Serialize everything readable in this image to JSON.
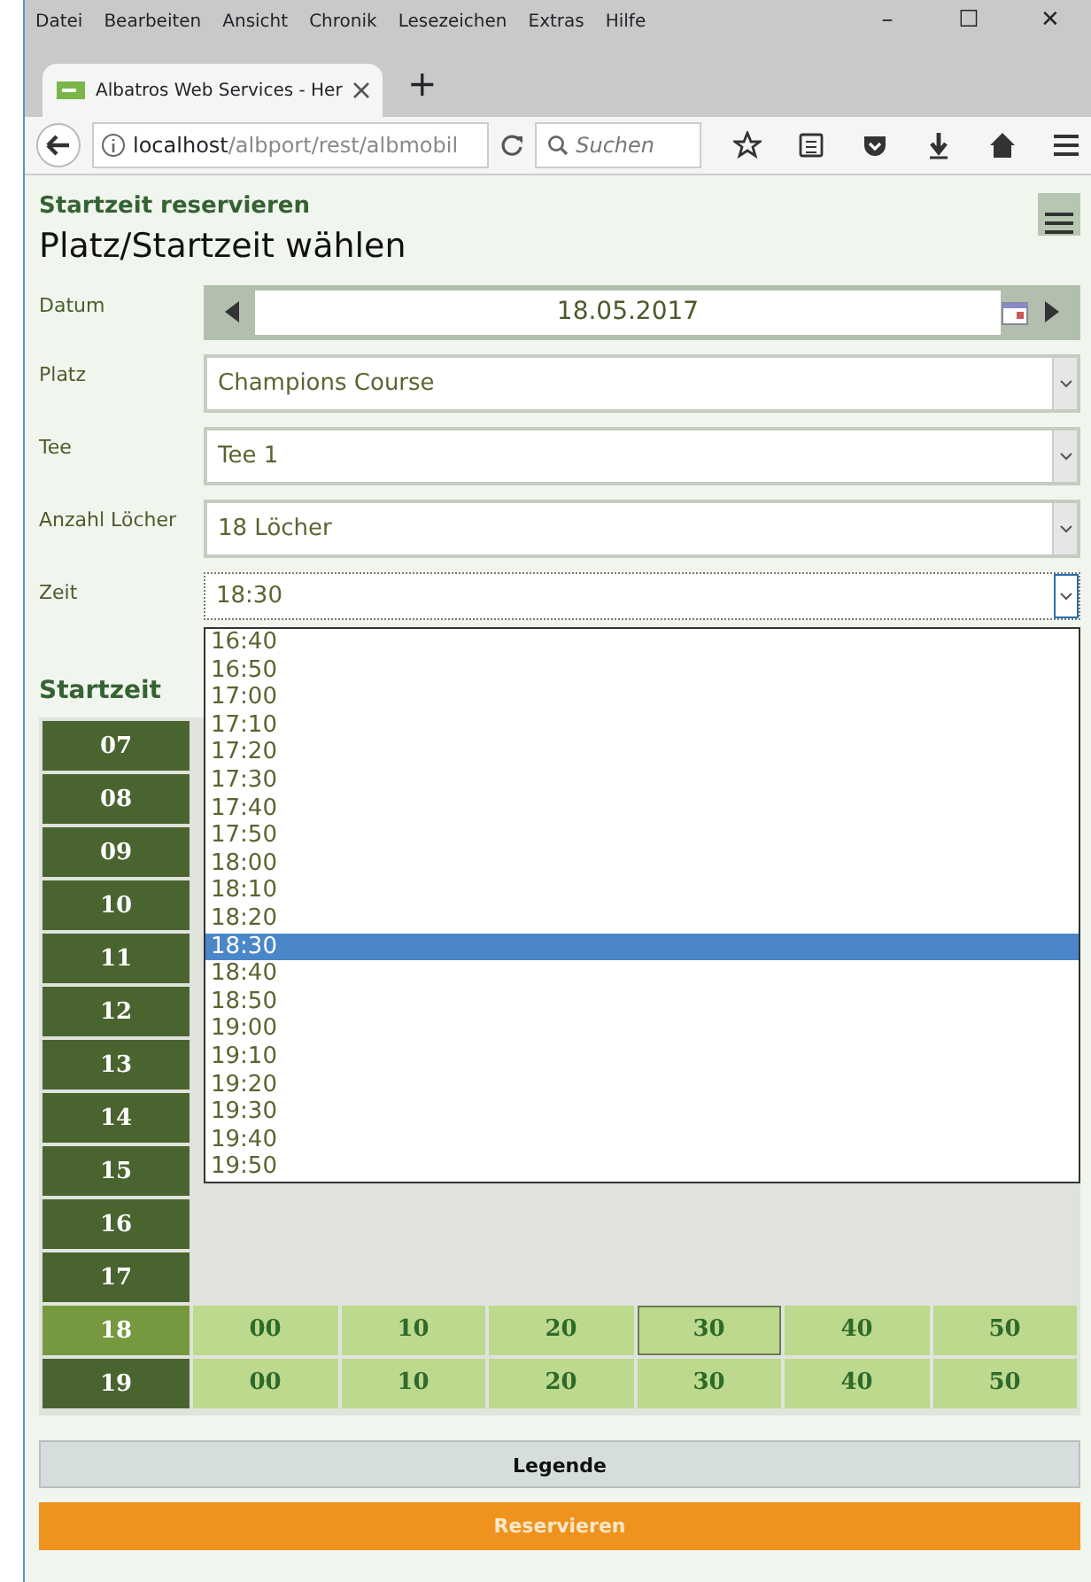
{
  "browser": {
    "menu": [
      "Datei",
      "Bearbeiten",
      "Ansicht",
      "Chronik",
      "Lesezeichen",
      "Extras",
      "Hilfe"
    ],
    "window_controls": [
      "–",
      "☐",
      "✕"
    ],
    "tabs": [
      {
        "label": "Albatros Web Services - Her",
        "selected": true
      }
    ],
    "new_tab": "+",
    "url_host": "localhost",
    "url_path": "/albport/rest/albmobil",
    "search": {
      "placeholder": "Suchen"
    }
  },
  "page": {
    "kicker": "Startzeit reservieren",
    "title": "Platz/Startzeit wählen",
    "form": [
      {
        "kind": "date",
        "label": "Datum",
        "value": "18.05.2017"
      },
      {
        "kind": "select",
        "label": "Platz",
        "value": "Champions Course",
        "expanded": false
      },
      {
        "kind": "select",
        "label": "Tee",
        "value": "Tee 1",
        "expanded": false
      },
      {
        "kind": "select",
        "label": "Anzahl Löcher",
        "value": "18 Löcher",
        "expanded": false
      },
      {
        "kind": "select",
        "label": "Zeit",
        "value": "18:30",
        "expanded": true
      }
    ],
    "dropdown": [
      {
        "label": "16:40",
        "selected": false
      },
      {
        "label": "16:50",
        "selected": false
      },
      {
        "label": "17:00",
        "selected": false
      },
      {
        "label": "17:10",
        "selected": false
      },
      {
        "label": "17:20",
        "selected": false
      },
      {
        "label": "17:30",
        "selected": false
      },
      {
        "label": "17:40",
        "selected": false
      },
      {
        "label": "17:50",
        "selected": false
      },
      {
        "label": "18:00",
        "selected": false
      },
      {
        "label": "18:10",
        "selected": false
      },
      {
        "label": "18:20",
        "selected": false
      },
      {
        "label": "18:30",
        "selected": true
      },
      {
        "label": "18:40",
        "selected": false
      },
      {
        "label": "18:50",
        "selected": false
      },
      {
        "label": "19:00",
        "selected": false
      },
      {
        "label": "19:10",
        "selected": false
      },
      {
        "label": "19:20",
        "selected": false
      },
      {
        "label": "19:30",
        "selected": false
      },
      {
        "label": "19:40",
        "selected": false
      },
      {
        "label": "19:50",
        "selected": false
      }
    ],
    "grid_title": "Startzeit",
    "hours": [
      {
        "hour": "07",
        "selected": false
      },
      {
        "hour": "08",
        "selected": false
      },
      {
        "hour": "09",
        "selected": false
      },
      {
        "hour": "10",
        "selected": false
      },
      {
        "hour": "11",
        "selected": false
      },
      {
        "hour": "12",
        "selected": false
      },
      {
        "hour": "13",
        "selected": false
      },
      {
        "hour": "14",
        "selected": false
      },
      {
        "hour": "15",
        "selected": false
      },
      {
        "hour": "16",
        "selected": false
      },
      {
        "hour": "17",
        "selected": false
      },
      {
        "hour": "18",
        "selected": true,
        "slots": [
          {
            "label": "00",
            "selected": false
          },
          {
            "label": "10",
            "selected": false
          },
          {
            "label": "20",
            "selected": false
          },
          {
            "label": "30",
            "selected": true
          },
          {
            "label": "40",
            "selected": false
          },
          {
            "label": "50",
            "selected": false
          }
        ]
      },
      {
        "hour": "19",
        "selected": false,
        "slots": [
          {
            "label": "00",
            "selected": false
          },
          {
            "label": "10",
            "selected": false
          },
          {
            "label": "20",
            "selected": false
          },
          {
            "label": "30",
            "selected": false
          },
          {
            "label": "40",
            "selected": false
          },
          {
            "label": "50",
            "selected": false
          }
        ]
      }
    ],
    "legend_button": "Legende",
    "reserve_button": "Reservieren"
  }
}
